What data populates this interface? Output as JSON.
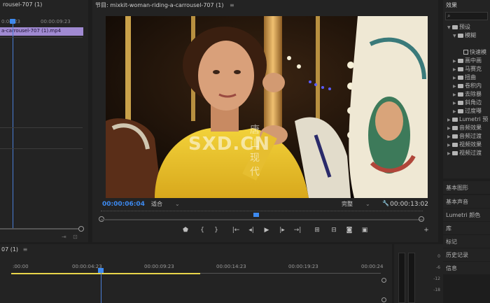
{
  "left_panel": {
    "tab_title": "rousel-707 (1)",
    "timecode_a": "0:04:23",
    "timecode_b": "00:00:09:23",
    "clip_name": "a-carrousel-707 (1).mp4"
  },
  "program_monitor": {
    "title": "节目: mixkit-woman-riding-a-carrousel-707 (1)",
    "menu_icon": "≡",
    "current_time": "00:00:06:04",
    "zoom_select": "适合",
    "quality_select": "完整",
    "duration": "00:00:13:02",
    "watermark": {
      "text_latin": "SXD.CN",
      "text_cn": "唐山现代"
    }
  },
  "effects_panel": {
    "title": "效果",
    "search_icon": "search-icon",
    "tree": [
      {
        "label": "预设",
        "level": 0,
        "expanded": true,
        "type": "folder"
      },
      {
        "label": "模糊",
        "level": 1,
        "expanded": true,
        "type": "folder"
      },
      {
        "label": "快速模",
        "level": 2,
        "type": "effect",
        "selected": true
      },
      {
        "label": "快速模",
        "level": 2,
        "type": "effect"
      },
      {
        "label": "画中画",
        "level": 1,
        "type": "folder"
      },
      {
        "label": "马赛克",
        "level": 1,
        "type": "folder"
      },
      {
        "label": "扭曲",
        "level": 1,
        "type": "folder"
      },
      {
        "label": "卷积内",
        "level": 1,
        "type": "folder"
      },
      {
        "label": "去除暴",
        "level": 1,
        "type": "folder"
      },
      {
        "label": "斜角边",
        "level": 1,
        "type": "folder"
      },
      {
        "label": "过度曝",
        "level": 1,
        "type": "folder"
      },
      {
        "label": "Lumetri 预",
        "level": 0,
        "type": "folder"
      },
      {
        "label": "音频效果",
        "level": 0,
        "type": "folder"
      },
      {
        "label": "音频过渡",
        "level": 0,
        "type": "folder"
      },
      {
        "label": "视频效果",
        "level": 0,
        "type": "folder"
      },
      {
        "label": "视频过渡",
        "level": 0,
        "type": "folder"
      }
    ]
  },
  "stacked_panels": [
    "基本图形",
    "基本声音",
    "Lumetri 颜色",
    "库",
    "标记",
    "历史记录",
    "信息"
  ],
  "timeline": {
    "tab_title": "07 (1)",
    "ruler_labels": [
      ":00:00",
      "00:00:04:23",
      "00:00:09:23",
      "00:00:14:23",
      "00:00:19:23",
      "00:00:24"
    ]
  },
  "meter": {
    "labels": [
      "0",
      "-6",
      "-12",
      "-18"
    ]
  }
}
